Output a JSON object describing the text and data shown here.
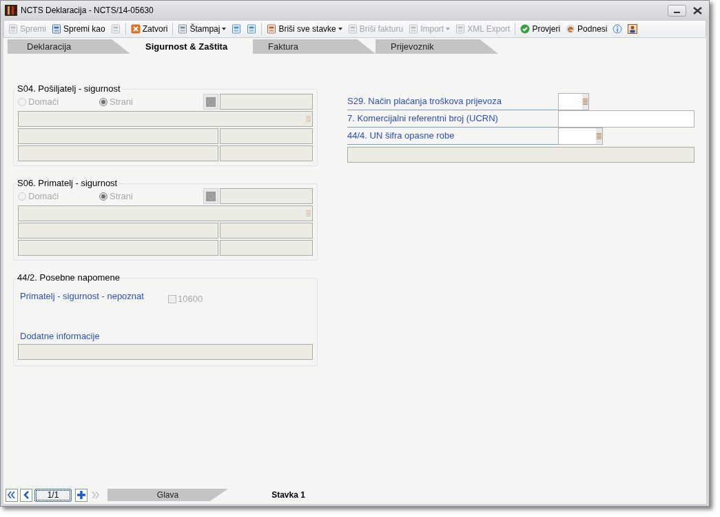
{
  "window": {
    "title": "NCTS Deklaracija - NCTS/14-05630"
  },
  "toolbar": [
    {
      "kind": "button",
      "label": "Spremi",
      "disabled": true
    },
    {
      "kind": "button",
      "label": "Spremi kao",
      "disabled": false
    },
    {
      "kind": "icon",
      "disabled": true
    },
    {
      "kind": "separator"
    },
    {
      "kind": "button",
      "label": "Zatvori",
      "disabled": false
    },
    {
      "kind": "separator"
    },
    {
      "kind": "button",
      "label": "Štampaj",
      "disabled": false,
      "dropdown": true
    },
    {
      "kind": "icon",
      "disabled": false
    },
    {
      "kind": "icon",
      "disabled": false
    },
    {
      "kind": "separator"
    },
    {
      "kind": "button",
      "label": "Briši sve stavke",
      "disabled": false,
      "dropdown": true
    },
    {
      "kind": "button",
      "label": "Briši fakturu",
      "disabled": true
    },
    {
      "kind": "button",
      "label": "Import",
      "disabled": true,
      "dropdown": true
    },
    {
      "kind": "button",
      "label": "XML Export",
      "disabled": true
    },
    {
      "kind": "separator"
    },
    {
      "kind": "button",
      "label": "Provjeri",
      "disabled": false
    },
    {
      "kind": "button",
      "label": "Podnesi",
      "disabled": false
    },
    {
      "kind": "icon",
      "disabled": false
    },
    {
      "kind": "icon",
      "disabled": false
    }
  ],
  "tabs": [
    {
      "label": "Deklaracija",
      "selected": false
    },
    {
      "label": "Sigurnost & Zaštita",
      "selected": true
    },
    {
      "label": "Faktura",
      "selected": false
    },
    {
      "label": "Prijevoznik",
      "selected": false
    }
  ],
  "parties": [
    {
      "title": "S04. Pošiljatelj - sigurnost",
      "disabled": true,
      "radios": [
        {
          "label": "Domaći",
          "selected": false
        },
        {
          "label": "Strani",
          "selected": true
        }
      ]
    },
    {
      "title": "S06. Primatelj - sigurnost",
      "disabled": true,
      "radios": [
        {
          "label": "Domaći",
          "selected": false
        },
        {
          "label": "Strani",
          "selected": true
        }
      ]
    }
  ],
  "remarks": {
    "title": "44/2. Posebne napomene",
    "unknown_label": "Primatelj - sigurnost - nepoznat",
    "checkbox": {
      "label": "10600",
      "checked": false,
      "disabled": true
    },
    "additional_label": "Dodatne informacije"
  },
  "right_fields": [
    {
      "label": "S29. Način plaćanja troškova prijevoza",
      "kind": "lookup"
    },
    {
      "label": "7. Komercijalni referentni broj (UCRN)",
      "kind": "text"
    },
    {
      "label": "44/4. UN šifra opasne robe",
      "kind": "lookup"
    }
  ],
  "pager": {
    "value": "1/1"
  },
  "bottom_tabs": [
    {
      "label": "Glava",
      "selected": false
    },
    {
      "label": "Stavka 1",
      "selected": true
    }
  ]
}
